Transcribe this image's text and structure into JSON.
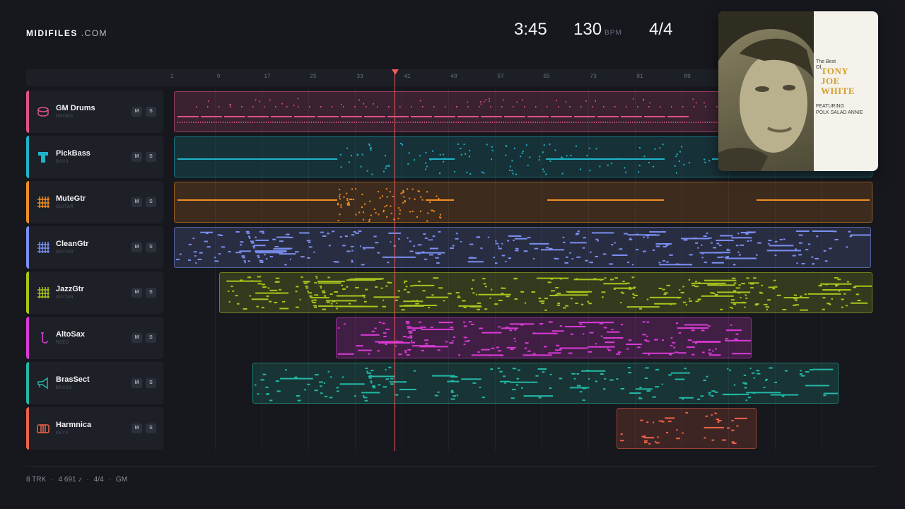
{
  "brand": {
    "bold": "MIDIFILES",
    "light": ".COM"
  },
  "header": {
    "time": "3:45",
    "bpm": "130",
    "bpm_unit": "BPM",
    "time_signature": "4/4"
  },
  "ruler": {
    "ticks": [
      "1",
      "9",
      "17",
      "25",
      "33",
      "41",
      "49",
      "57",
      "65",
      "73",
      "81",
      "89"
    ]
  },
  "tracks": [
    {
      "name": "GM Drums",
      "category": "DRUMS",
      "icon": "drum-icon",
      "color": "#e0528a",
      "mute": "M",
      "solo": "S"
    },
    {
      "name": "PickBass",
      "category": "BASS",
      "icon": "bass-icon",
      "color": "#1eb3c8",
      "mute": "M",
      "solo": "S"
    },
    {
      "name": "MuteGtr",
      "category": "GUITAR",
      "icon": "guitar-icon",
      "color": "#f08d25",
      "mute": "M",
      "solo": "S"
    },
    {
      "name": "CleanGtr",
      "category": "GUITAR",
      "icon": "guitar-icon",
      "color": "#7b8ff0",
      "mute": "M",
      "solo": "S"
    },
    {
      "name": "JazzGtr",
      "category": "GUITAR",
      "icon": "guitar-icon",
      "color": "#a8c41e",
      "mute": "M",
      "solo": "S"
    },
    {
      "name": "AltoSax",
      "category": "REED",
      "icon": "sax-icon",
      "color": "#d93ad6",
      "mute": "M",
      "solo": "S"
    },
    {
      "name": "BrasSect",
      "category": "BRASS",
      "icon": "trumpet-icon",
      "color": "#22b9a6",
      "mute": "M",
      "solo": "S"
    },
    {
      "name": "Harmnica",
      "category": "KEYS",
      "icon": "keys-icon",
      "color": "#ee6246",
      "mute": "M",
      "solo": "S"
    }
  ],
  "footer": {
    "tracks": "8 TRK",
    "notes": "4 691 ♪",
    "signature": "4/4",
    "standard": "GM",
    "separator": "·"
  },
  "album": {
    "pre": "The Best",
    "of": "Of",
    "line1": "TONY",
    "line2": "JOE",
    "line3": "WHITE",
    "featuring": "FEATURING",
    "song": "POLK SALAD ANNIE"
  }
}
